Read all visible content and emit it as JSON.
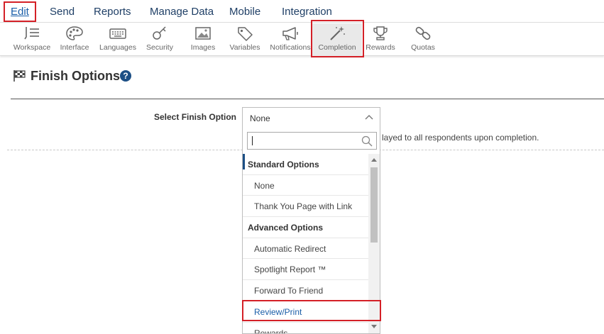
{
  "menu": {
    "items": [
      {
        "label": "Edit",
        "active": true
      },
      {
        "label": "Send"
      },
      {
        "label": "Reports"
      },
      {
        "label": "Manage Data"
      },
      {
        "label": "Mobile"
      },
      {
        "label": "Integration"
      }
    ]
  },
  "toolbar": {
    "items": [
      {
        "label": "Workspace",
        "icon": "workspace-icon"
      },
      {
        "label": "Interface",
        "icon": "palette-icon"
      },
      {
        "label": "Languages",
        "icon": "keyboard-icon"
      },
      {
        "label": "Security",
        "icon": "key-icon"
      },
      {
        "label": "Images",
        "icon": "image-icon"
      },
      {
        "label": "Variables",
        "icon": "tag-icon"
      },
      {
        "label": "Notifications",
        "icon": "megaphone-icon"
      },
      {
        "label": "Completion",
        "icon": "magic-wand-icon",
        "active": true
      },
      {
        "label": "Rewards",
        "icon": "trophy-icon"
      },
      {
        "label": "Quotas",
        "icon": "link-icon"
      }
    ]
  },
  "page": {
    "title": "Finish Options",
    "help_icon": "help-icon"
  },
  "field": {
    "label": "Select Finish Option",
    "selected": "None",
    "helper_text": "layed to all respondents upon completion."
  },
  "dropdown": {
    "search_value": "",
    "groups": [
      {
        "label": "Standard Options",
        "options": [
          "None",
          "Thank You Page with Link"
        ]
      },
      {
        "label": "Advanced Options",
        "options": [
          "Automatic Redirect",
          "Spotlight Report ™",
          "Forward To Friend",
          "Review/Print",
          "Rewards"
        ]
      }
    ],
    "highlighted_option": "Review/Print"
  },
  "colors": {
    "accent": "#1a5ea8",
    "menu_text": "#1f3f66",
    "highlight_border": "#d42027"
  }
}
